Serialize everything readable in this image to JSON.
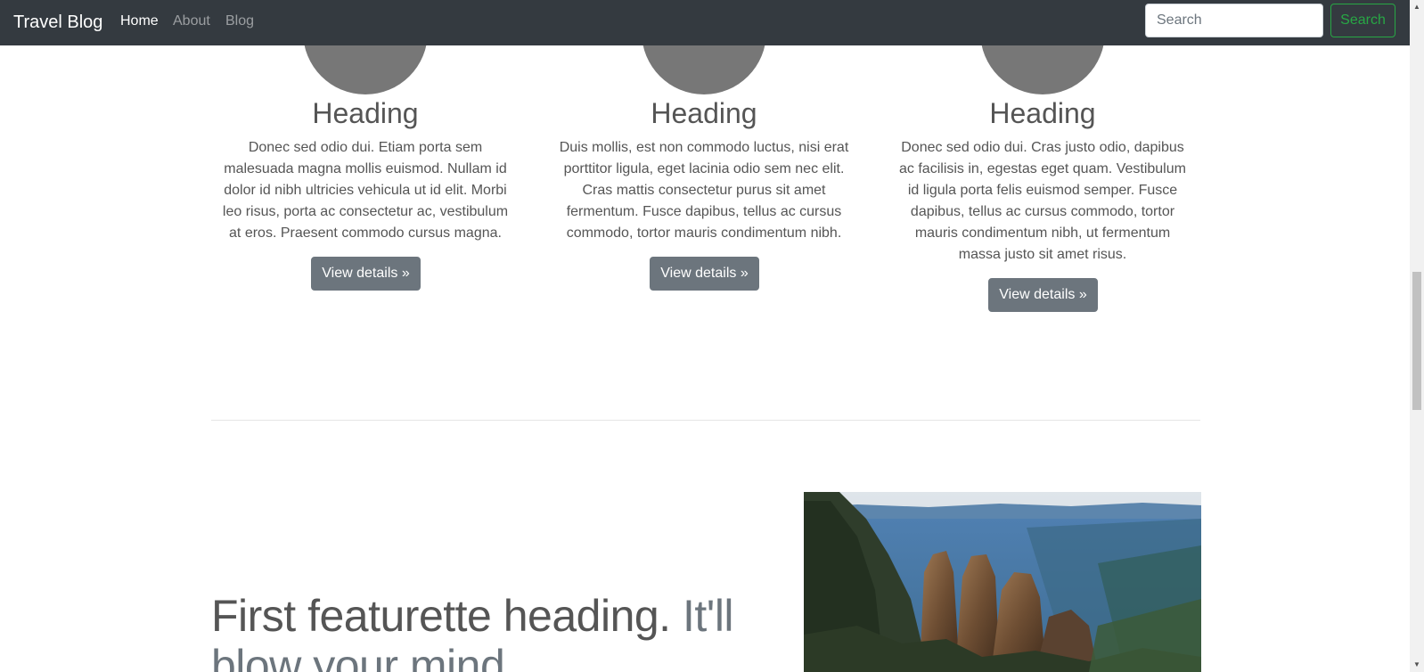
{
  "navbar": {
    "brand": "Travel Blog",
    "links": [
      {
        "label": "Home",
        "active": true
      },
      {
        "label": "About",
        "active": false
      },
      {
        "label": "Blog",
        "active": false
      }
    ],
    "search_placeholder": "Search",
    "search_button": "Search"
  },
  "columns": [
    {
      "heading": "Heading",
      "text": "Donec sed odio dui. Etiam porta sem malesuada magna mollis euismod. Nullam id dolor id nibh ultricies vehicula ut id elit. Morbi leo risus, porta ac consectetur ac, vestibulum at eros. Praesent commodo cursus magna.",
      "button": "View details »"
    },
    {
      "heading": "Heading",
      "text": "Duis mollis, est non commodo luctus, nisi erat porttitor ligula, eget lacinia odio sem nec elit. Cras mattis consectetur purus sit amet fermentum. Fusce dapibus, tellus ac cursus commodo, tortor mauris condimentum nibh.",
      "button": "View details »"
    },
    {
      "heading": "Heading",
      "text": "Donec sed odio dui. Cras justo odio, dapibus ac facilisis in, egestas eget quam. Vestibulum id ligula porta felis euismod semper. Fusce dapibus, tellus ac cursus commodo, tortor mauris condimentum nibh, ut fermentum massa justo sit amet risus.",
      "button": "View details »"
    }
  ],
  "featurette": {
    "heading": "First featurette heading.",
    "heading_muted": "It'll blow your mind."
  },
  "colors": {
    "navbar_bg": "#343a40",
    "success": "#28a745",
    "secondary": "#6c757d",
    "placeholder_circle": "#777777"
  }
}
